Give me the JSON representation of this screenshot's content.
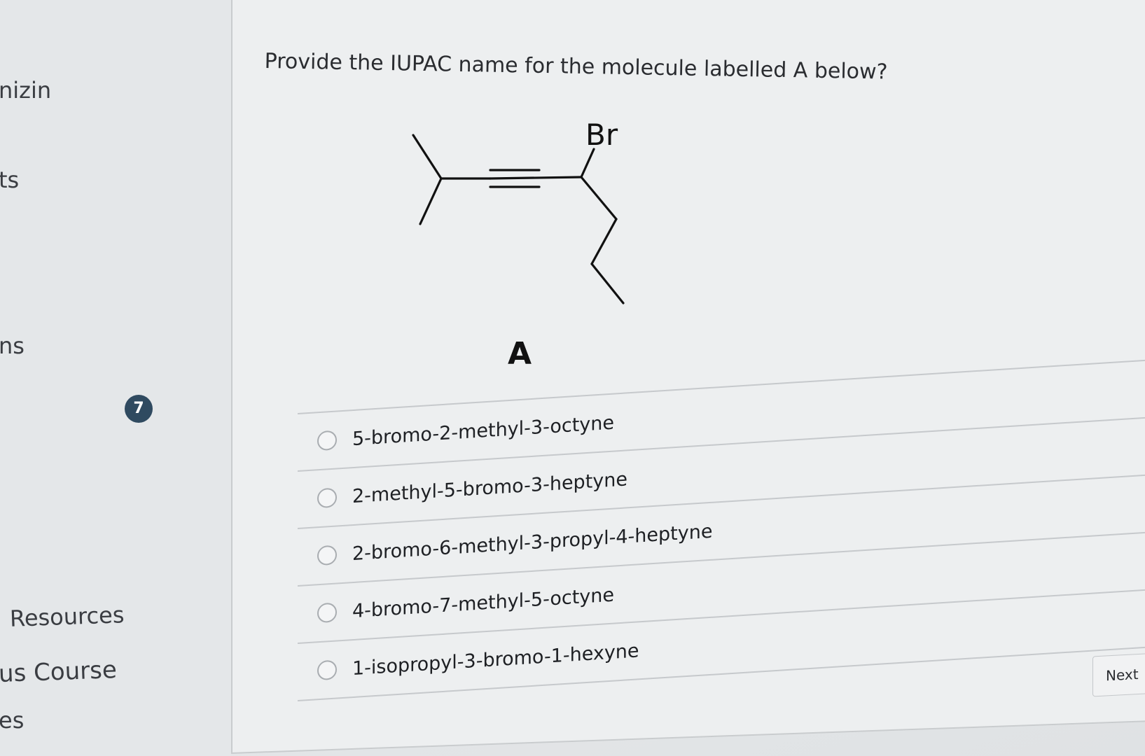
{
  "sidebar": {
    "items": [
      {
        "label": "nizin"
      },
      {
        "label": "ts"
      },
      {
        "label": "ns"
      },
      {
        "label": "Resources"
      },
      {
        "label": "us Course"
      },
      {
        "label": "es"
      }
    ],
    "badge": "7"
  },
  "question": {
    "text": "Provide the IUPAC name for the molecule labelled A below?",
    "atom_label": "Br",
    "molecule_label": "A"
  },
  "options": [
    {
      "label": "5-bromo-2-methyl-3-octyne",
      "selected": false
    },
    {
      "label": "2-methyl-5-bromo-3-heptyne",
      "selected": false
    },
    {
      "label": "2-bromo-6-methyl-3-propyl-4-heptyne",
      "selected": false
    },
    {
      "label": "4-bromo-7-methyl-5-octyne",
      "selected": false
    },
    {
      "label": "1-isopropyl-3-bromo-1-hexyne",
      "selected": false
    }
  ],
  "navigation": {
    "next_label": "Next"
  }
}
